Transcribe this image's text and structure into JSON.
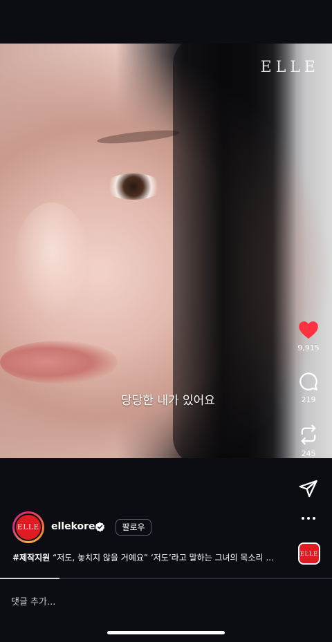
{
  "video": {
    "watermark": "ELLE",
    "subtitle": "당당한 내가 있어요"
  },
  "actions": {
    "like_count": "9,915",
    "comment_count": "219",
    "share_count": "245"
  },
  "post": {
    "avatar_text": "ELLE",
    "username": "ellekorea",
    "follow_label": "팔로우",
    "caption_tag": "#제작지원",
    "caption_text": " “저도, 놓치지 않을 거예요” ‘저도’라고 말하는 그녀의 목소리 ...",
    "audio_thumb_text": "ELLE"
  },
  "progress": {
    "fraction": 0.18
  },
  "comment": {
    "placeholder": "댓글 추가..."
  },
  "colors": {
    "like_red": "#ff3040",
    "brand_red": "#e11b22",
    "background": "#0b0d12"
  }
}
